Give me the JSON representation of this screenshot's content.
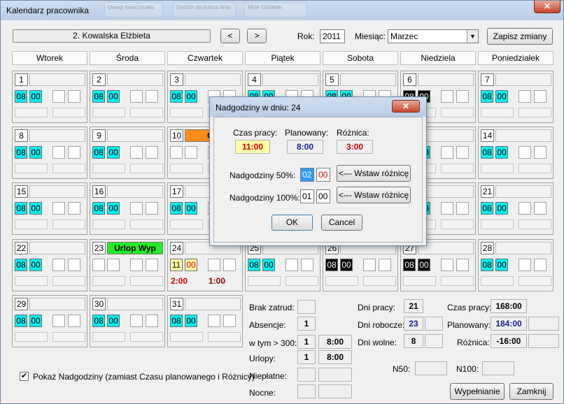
{
  "window": {
    "title": "Kalendarz pracownika",
    "close": "✕"
  },
  "ghost": [
    "Uwagi nauczyciela",
    "Godzin do końca dnia",
    "Moje Ostatnie"
  ],
  "header": {
    "employee": "2.  Kowalska  Elżbieta",
    "prev": "<",
    "next": ">",
    "year_label": "Rok:",
    "year_value": "2011",
    "month_label": "Miesiąc:",
    "month_value": "Marzec",
    "save": "Zapisz zmiany"
  },
  "days": [
    "Wtorek",
    "Środa",
    "Czwartek",
    "Piątek",
    "Sobota",
    "Niedziela",
    "Poniedziałek"
  ],
  "hour_default": "08",
  "min_default": "00",
  "tags": {
    "chor": "Ch",
    "urlop": "Urlop Wyp"
  },
  "cell24": {
    "h": "11",
    "m": "00",
    "r1": "2:00",
    "r2": "1:00"
  },
  "stats": {
    "brak": "Brak zatrud:",
    "absencje": "Absencje:",
    "absencje_v": "1",
    "w300": "w tym > 300:",
    "w300_a": "1",
    "w300_b": "8:00",
    "urlopy": "Urlopy:",
    "urlopy_a": "1",
    "urlopy_b": "8:00",
    "nieplatne": "Niepłatne:",
    "nocne": "Nocne:",
    "dni_pracy": "Dni pracy:",
    "dni_pracy_v": "21",
    "dni_robocze": "Dni robocze:",
    "dni_robocze_v": "23",
    "dni_wolne": "Dni wolne:",
    "dni_wolne_v": "8",
    "czas_pracy": "Czas pracy:",
    "czas_pracy_v": "168:00",
    "planowany": "Planowany:",
    "planowany_v": "184:00",
    "roznica": "Różnica:",
    "roznica_v": "-16:00",
    "n50": "N50:",
    "n100": "N100:"
  },
  "footer": {
    "checkbox": "Pokaż Nadgodziny (zamiast Czasu planowanego i Różnicy)",
    "check": "✔",
    "fill": "Wypełnianie",
    "close": "Zamknij"
  },
  "dialog": {
    "title": "Nadgodziny w dniu:  24",
    "czas": "Czas pracy:",
    "czas_v": "11:00",
    "plan": "Planowany:",
    "plan_v": "8:00",
    "roz": "Różnica:",
    "roz_v": "3:00",
    "n50": "Nadgodziny 50%:",
    "n50_h": "02",
    "n50_m": "00",
    "n100": "Nadgodziny 100%:",
    "n100_h": "01",
    "n100_m": "00",
    "insert": "<--- Wstaw różnicę",
    "ok": "OK",
    "cancel": "Cancel",
    "close": "✕"
  },
  "colors": {
    "cyan": "#00eeee",
    "orange": "#ff8c1a",
    "green": "#22ee22",
    "yellow": "#ffffa8",
    "red": "#cc0000",
    "blue": "#1a1aa0"
  }
}
